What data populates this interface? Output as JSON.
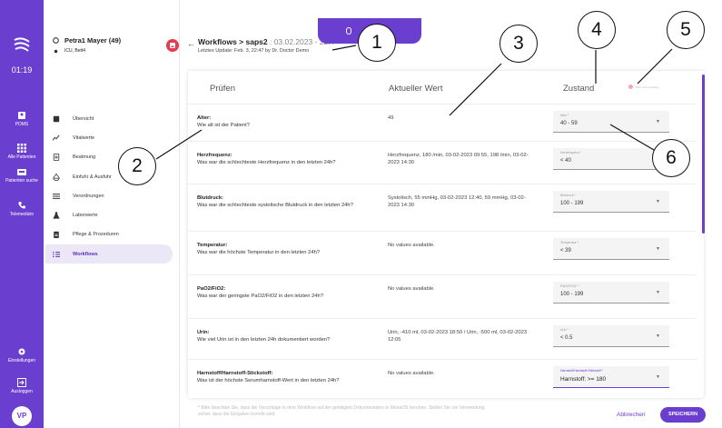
{
  "rail": {
    "time": "01:19",
    "items": [
      {
        "label": "PDMS",
        "icon": "patient-icon"
      },
      {
        "label": "Alle Patienten",
        "icon": "grid-icon"
      },
      {
        "label": "Patienten suche",
        "icon": "bed-icon"
      },
      {
        "label": "Telemedizin",
        "icon": "phone-icon"
      },
      {
        "label": "Einstellungen",
        "icon": "gear-icon"
      },
      {
        "label": "Ausloggen",
        "icon": "logout-icon"
      }
    ],
    "avatar": "VP"
  },
  "patient": {
    "name": "Petra1 Mayer (49)",
    "bed": "ICU, Bett4"
  },
  "nav": [
    {
      "label": "Übersicht",
      "icon": "overview-icon"
    },
    {
      "label": "Vitalwerte",
      "icon": "vitals-icon"
    },
    {
      "label": "Beatmung",
      "icon": "ventilation-icon"
    },
    {
      "label": "Einfuhr & Ausfuhr",
      "icon": "fluid-icon"
    },
    {
      "label": "Verordnungen",
      "icon": "list-icon"
    },
    {
      "label": "Laborwerte",
      "icon": "lab-icon"
    },
    {
      "label": "Pflege & Prozeduren",
      "icon": "clipboard-icon"
    },
    {
      "label": "Workflows",
      "icon": "workflow-icon",
      "active": true
    }
  ],
  "header": {
    "breadcrumb": "Workflows > saps2",
    "date": " : 03.02.2023 - 22:4",
    "updated": "Letztes Update: Feb. 3, 22:47 by Dr. Doctor Demo"
  },
  "annotations": [
    "1",
    "2",
    "3",
    "4",
    "5",
    "6"
  ],
  "table": {
    "col_check": "Prüfen",
    "col_value": "Aktueller Wert",
    "col_state": "Zustand",
    "legend": "Wert nicht bestätigt",
    "rows": [
      {
        "title": "Alter:",
        "question": "Wie alt ist der Patient?",
        "value": "49",
        "sel_label": "Alter *",
        "sel_value": "40 - 59"
      },
      {
        "title": "Herzfrequenz:",
        "question": "Was war die schlechteste Herzfrequenz in den letzten 24h?",
        "value": "Herzfrequenz, 180 /min, 03-02-2023 09:55, 198 /min, 03-02-2023 14:30",
        "sel_label": "Herzfrequenz *",
        "sel_value": "< 40"
      },
      {
        "title": "Blutdruck:",
        "question": "Was war die schlechteste systolische Blutdruck in den letzten 24h?",
        "value": "Systolisch, 55 mmHg, 03-02-2023 12:40, 59 mmHg, 03-02-2023 14:30",
        "sel_label": "Blutdruck *",
        "sel_value": "100 - 199"
      },
      {
        "title": "Temperatur:",
        "question": "Was war die höchste Temperatur in den letzten 24h?",
        "value": "No values available.",
        "sel_label": "Temperatur *",
        "sel_value": "< 39"
      },
      {
        "title": "PaO2/FiO2:",
        "question": "Was war der geringste PaO2/FiO2 in den letzten 24h?",
        "value": "No values available.",
        "sel_label": "PaO2/FiO2 *",
        "sel_value": "100 - 199"
      },
      {
        "title": "Urin:",
        "question": "Wie viel Urin ist in den letzten 24h dokumentiert worden?",
        "value": "Urin, -410 ml, 03-02-2023 18:50 / Urin, -500 ml, 03-02-2023 12:05",
        "sel_label": "Urin *",
        "sel_value": "< 0.5"
      },
      {
        "title": "Harnstoff/Harnstoff-Stickstoff:",
        "question": "Was ist der höchste Serumharnstoff-Wert in den letzten 24h?",
        "value": "No values available.",
        "sel_label": "Harnstoff/Harnstoff-Stickstoff *",
        "sel_value": "Harnstoff: >= 180"
      }
    ]
  },
  "footer": {
    "note": "* Bitte beachten Sie, dass die Vorschläge in dem Workflow auf der getätigten Dokumentation in MonaOS beruhen. Stellen Sie vor Verwendung sicher, dass die Eingaben korrekt sind.",
    "cancel": "Abbrechen",
    "save": "SPEICHERN"
  },
  "colors": {
    "accent": "#6a3fd0",
    "alert": "#e33b50"
  }
}
